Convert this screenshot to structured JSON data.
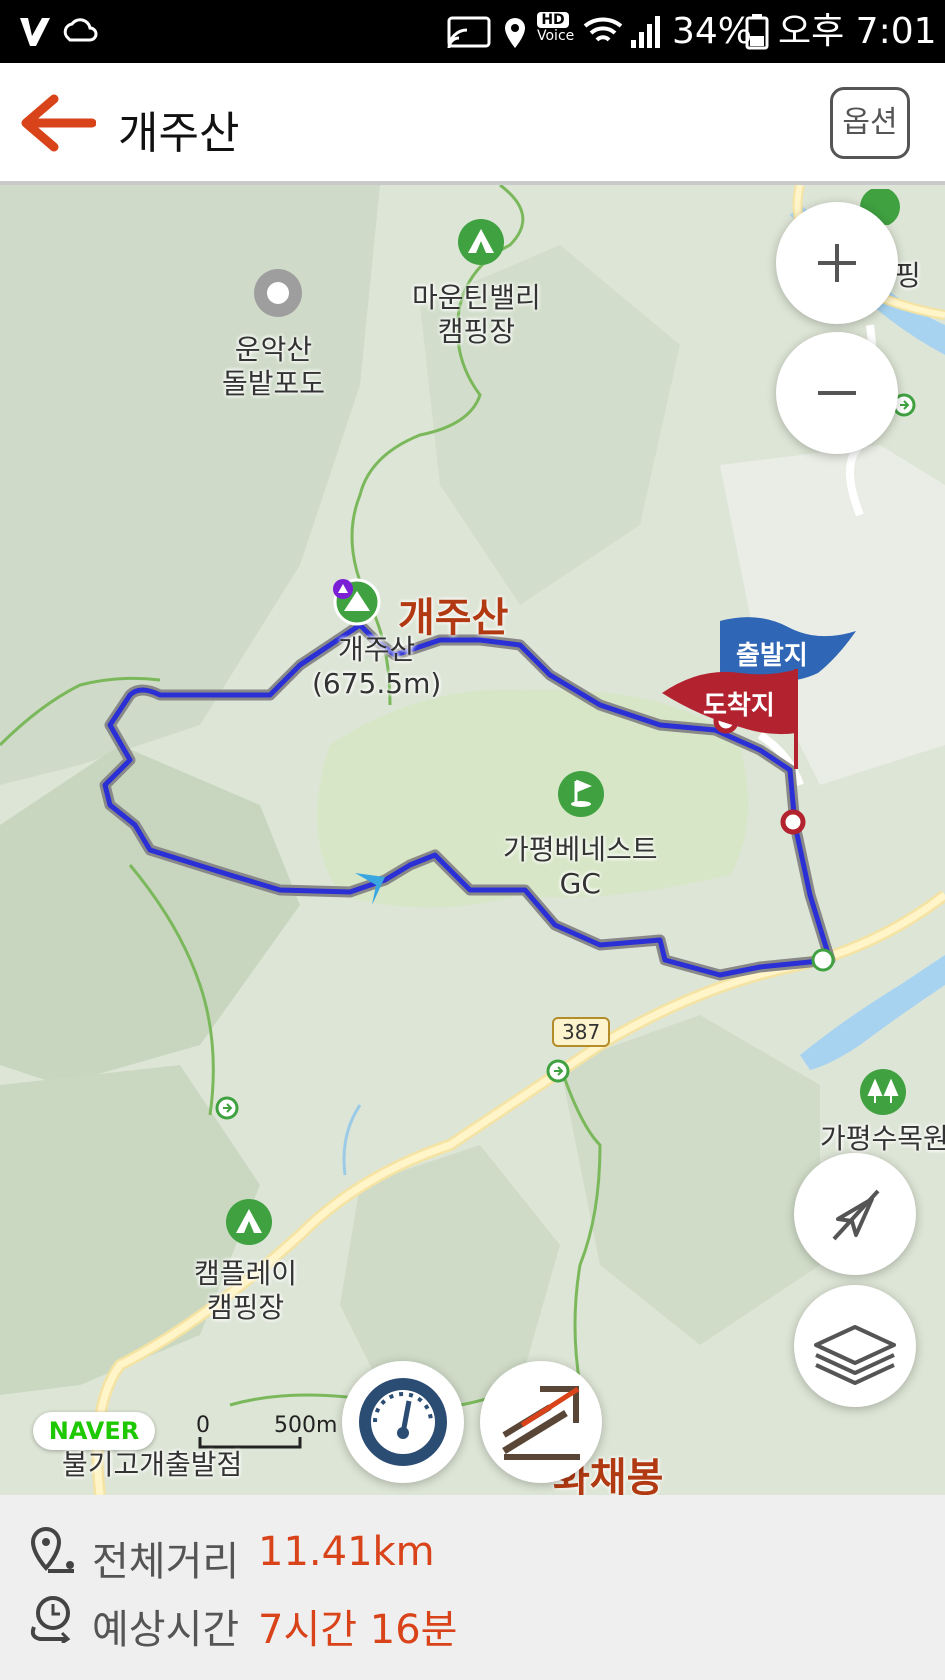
{
  "status_bar": {
    "battery": "34%",
    "time": "오후 7:01",
    "hd_label": "HD",
    "voice_label": "Voice"
  },
  "header": {
    "title": "개주산",
    "option_label": "옵션"
  },
  "map": {
    "pois": {
      "camp_mountain_valley": "마운틴밸리\n캠핑장",
      "winery": "운악산\n돌밭포도",
      "peak_name": "개주산",
      "peak_elevation": "개주산\n(675.5m)",
      "golf": "가평베네스트\nGC",
      "camp_play": "캠플레이\n캠핑장",
      "arboretum": "가평수목원",
      "peak_south": "화채봉",
      "exit_point": "불기고개출발점",
      "camping_right": "핑"
    },
    "flags": {
      "start": "출발지",
      "end": "도착지"
    },
    "road_number": "387",
    "scale": {
      "zero": "0",
      "distance": "500m"
    },
    "logo": "NAVER"
  },
  "footer": {
    "distance_label": "전체거리",
    "distance_value": "11.41km",
    "time_label": "예상시간",
    "time_value": "7시간 16분"
  },
  "colors": {
    "route": "#2a2fd6",
    "accent": "#d9431a",
    "start_flag": "#2f66b5",
    "end_flag": "#b3222f"
  },
  "icons": {
    "back": "arrow-left-icon",
    "zoom_in": "plus-icon",
    "zoom_out": "minus-icon",
    "compass_off": "compass-off-icon",
    "layers": "layers-icon",
    "speedometer": "speedometer-icon",
    "elevation": "elevation-icon",
    "distance": "location-distance-icon",
    "time": "clock-icon"
  }
}
